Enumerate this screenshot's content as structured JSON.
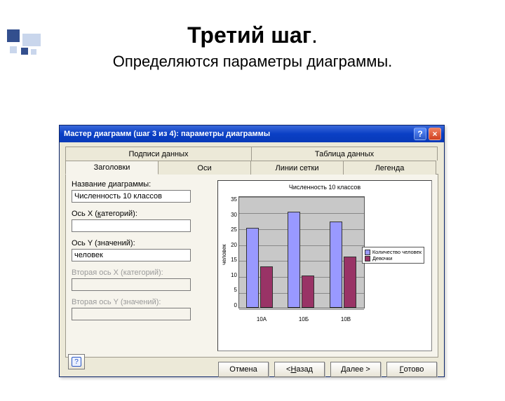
{
  "slide": {
    "title_main": "Третий шаг",
    "title_dot": ".",
    "subtitle": "Определяются параметры диаграммы."
  },
  "dialog": {
    "title": "Мастер диаграмм (шаг 3 из 4): параметры диаграммы",
    "help_icon": "?",
    "close_icon": "×",
    "tabs_back": [
      "Подписи данных",
      "Таблица данных"
    ],
    "tabs_front": [
      "Заголовки",
      "Оси",
      "Линии сетки",
      "Легенда"
    ],
    "fields": {
      "chart_title": {
        "label": "Название диаграммы:",
        "value": "Численность 10 классов"
      },
      "axis_x": {
        "label_pre": "Ось X (",
        "label_u": "к",
        "label_post": "атегорий):",
        "value": ""
      },
      "axis_y": {
        "label": "Ось Y (значений):",
        "value": "человек"
      },
      "axis_x2": {
        "label": "Вторая ось X (категорий):",
        "value": ""
      },
      "axis_y2": {
        "label": "Вторая ось Y (значений):",
        "value": ""
      }
    },
    "buttons": {
      "cancel": "Отмена",
      "back_pre": "< ",
      "back_u": "Н",
      "back_post": "азад",
      "next_u": "Д",
      "next_post": "алее >",
      "finish_u": "Г",
      "finish_post": "отово"
    },
    "mini_help": "?"
  },
  "chart_data": {
    "type": "bar",
    "title": "Численность 10 классов",
    "ylabel": "человек",
    "categories": [
      "10А",
      "10Б",
      "10В"
    ],
    "series": [
      {
        "name": "Количество человек",
        "values": [
          25,
          30,
          27
        ]
      },
      {
        "name": "Девочки",
        "values": [
          13,
          10,
          16
        ]
      }
    ],
    "yticks": [
      35,
      30,
      25,
      20,
      15,
      10,
      5,
      0
    ],
    "ylim": [
      0,
      35
    ]
  }
}
